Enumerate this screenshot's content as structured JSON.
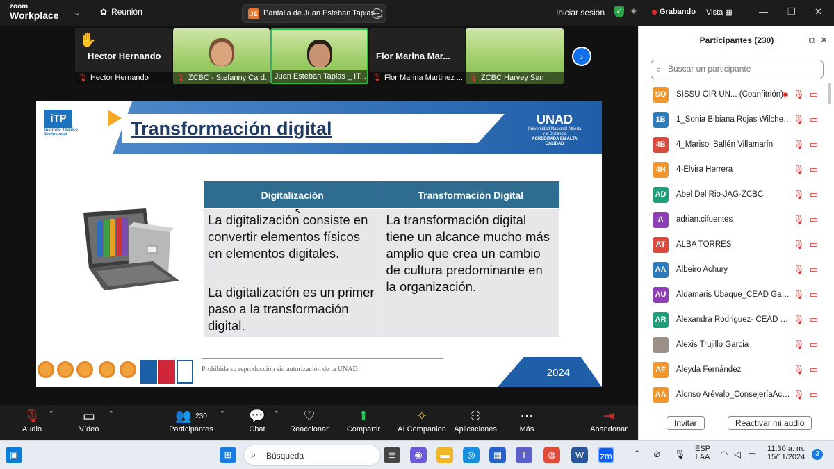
{
  "topbar": {
    "logo_line1": "zoom",
    "logo_line2": "Workplace",
    "meeting_label": "Reunión",
    "share_initials": "JE",
    "share_title": "Pantalla de Juan Esteban Tapias _",
    "signin": "Iniciar sesión",
    "recording": "Grabando",
    "view": "Vista"
  },
  "gallery": {
    "tiles": [
      {
        "name": "Hector Hernando",
        "caption": "Hector Hernando",
        "video": false
      },
      {
        "name": "",
        "caption": "ZCBC - Stefanny Card...",
        "video": true
      },
      {
        "name": "",
        "caption": "Juan Esteban Tapias _ IT...",
        "video": true
      },
      {
        "name": "Flor Marina Mar...",
        "caption": "Flor Marina Martinez ...",
        "video": false
      },
      {
        "name": "",
        "caption": "ZCBC Harvey San",
        "video": true
      }
    ]
  },
  "slide": {
    "itp_logo": "iTP",
    "itp_sub": "Instituto Técnico Profesional",
    "title": "Transformación digital",
    "unad_logo": "UNAD",
    "unad_sub": "Universidad Nacional Abierta y a Distancia",
    "unad_acc": "ACREDITADA EN ALTA CALIDAD",
    "table": {
      "headers": [
        "Digitalización",
        "Transformación Digital"
      ],
      "col1_cell1": "La digitalización consiste en convertir elementos físicos en elementos digitales.",
      "col1_cell2": "La digitalización es un primer paso a la transformación digital.",
      "col2_cell": "La transformación digital tiene un alcance mucho más amplio que crea un cambio de cultura predominante en la organización."
    },
    "footer_text": "Prohibida su reproducción sin autorización de la UNAD",
    "year": "2024"
  },
  "controls": {
    "audio": "Audio",
    "video": "Vídeo",
    "participants": "Participantes",
    "participants_count": "230",
    "chat": "Chat",
    "reactions": "Reaccionar",
    "share": "Compartir",
    "ai": "AI Companion",
    "apps": "Aplicaciones",
    "more": "Más",
    "leave": "Abandonar"
  },
  "panel": {
    "title": "Participantes (230)",
    "search_placeholder": "Buscar un participante",
    "participants": [
      {
        "initials": "SO",
        "name": "SISSU OIR UN... (Coanfitrión)",
        "color": "#f0962d"
      },
      {
        "initials": "1B",
        "name": "1_Sonia Bibiana Rojas Wilches_...",
        "color": "#2b7bbd"
      },
      {
        "initials": "4B",
        "name": "4_Marisol Ballén Villamarín",
        "color": "#d84b3c"
      },
      {
        "initials": "4H",
        "name": "4-Elvira Herrera",
        "color": "#f0962d"
      },
      {
        "initials": "AD",
        "name": "Abel Del Rio-JAG-ZCBC",
        "color": "#1f9e7a"
      },
      {
        "initials": "A",
        "name": "adrian.cifuentes",
        "color": "#8e3fb5"
      },
      {
        "initials": "AT",
        "name": "ALBA TORRES",
        "color": "#d84b3c"
      },
      {
        "initials": "AA",
        "name": "Albeiro Achury",
        "color": "#2b7bbd"
      },
      {
        "initials": "AU",
        "name": "Aldamaris Ubaque_CEAD Gach...",
        "color": "#8e3fb5"
      },
      {
        "initials": "AR",
        "name": "Alexandra Rodriguez- CEAD G...",
        "color": "#1f9e7a"
      },
      {
        "initials": "",
        "name": "Alexis Trujillo Garcia",
        "color": "#9b8f87"
      },
      {
        "initials": "AF",
        "name": "Aleyda Fernández",
        "color": "#f0962d"
      },
      {
        "initials": "AA",
        "name": "Alonso Arévalo_ConsejeríaAc_Z...",
        "color": "#f0962d"
      }
    ],
    "invite": "Invitar",
    "reactivate_audio": "Reactivar mi audio"
  },
  "taskbar": {
    "search": "Búsqueda",
    "lang1": "ESP",
    "lang2": "LAA",
    "time": "11:30 a. m.",
    "date": "15/11/2024",
    "notif": "3"
  }
}
